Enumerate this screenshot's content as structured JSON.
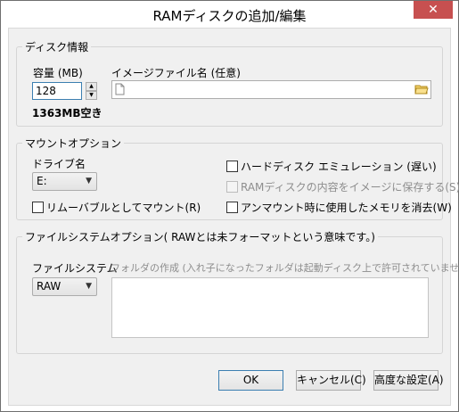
{
  "window": {
    "title": "RAMディスクの追加/編集",
    "close_label": "✕"
  },
  "disk_info": {
    "legend": "ディスク情報",
    "capacity_label": "容量 (MB)",
    "capacity_value": "128",
    "free_text": "1363MB空き",
    "image_file_label": "イメージファイル名 (任意)",
    "image_file_value": ""
  },
  "mount_options": {
    "legend": "マウントオプション",
    "drive_label": "ドライブ名",
    "drive_value": "E:",
    "removable_label": "リムーバブルとしてマウント(R)",
    "hdd_emulation_label": "ハードディスク エミュレーション (遅い)",
    "save_to_image_label": "RAMディスクの内容をイメージに保存する(S)",
    "erase_on_unmount_label": "アンマウント時に使用したメモリを消去(W)"
  },
  "fs_options": {
    "legend": "ファイルシステムオプション( RAWとは未フォーマットという意味です。)",
    "fs_label": "ファイルシステム",
    "fs_value": "RAW",
    "folder_create_label": "フォルダの作成 (入れ子になったフォルダは起動ディスク上で許可されていません)"
  },
  "buttons": {
    "ok": "OK",
    "cancel": "キャンセル(C)",
    "advanced": "高度な設定(A)"
  }
}
